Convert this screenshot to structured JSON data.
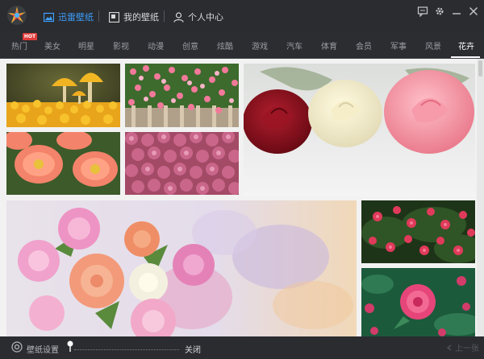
{
  "titlebar": {
    "tabs": [
      {
        "label": "迅雷壁纸",
        "active": true
      },
      {
        "label": "我的壁纸",
        "active": false
      },
      {
        "label": "个人中心",
        "active": false
      }
    ]
  },
  "categories": [
    {
      "label": "热门",
      "badge": "HOT"
    },
    {
      "label": "美女"
    },
    {
      "label": "明星"
    },
    {
      "label": "影视"
    },
    {
      "label": "动漫"
    },
    {
      "label": "创意"
    },
    {
      "label": "炫酷"
    },
    {
      "label": "游戏"
    },
    {
      "label": "汽车"
    },
    {
      "label": "体育"
    },
    {
      "label": "会员"
    },
    {
      "label": "军事"
    },
    {
      "label": "风景"
    },
    {
      "label": "花卉",
      "active": true
    }
  ],
  "bottombar": {
    "settings_label": "壁纸设置",
    "close_label": "关闭",
    "next_label": "上一张"
  },
  "colors": {
    "accent": "#3ea0ff",
    "titlebar_bg": "#2a2c30",
    "hot_badge": "#e23b3b"
  }
}
